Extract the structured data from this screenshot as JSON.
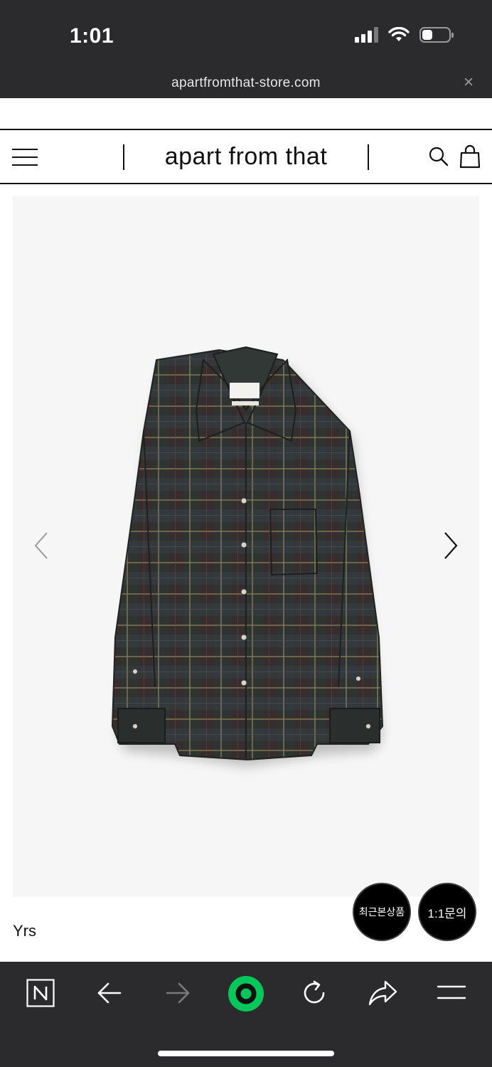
{
  "status_bar": {
    "time": "1:01",
    "icons": [
      "cellular-signal-icon",
      "wifi-icon",
      "battery-icon"
    ]
  },
  "browser": {
    "url": "apartfromthat-store.com",
    "close_icon": "×",
    "toolbar": [
      "naver-n-icon",
      "back-arrow-icon",
      "forward-arrow-icon",
      "naver-green-dot-icon",
      "reload-icon",
      "share-icon",
      "menu-icon"
    ],
    "accent_color": "#03c75a"
  },
  "site": {
    "brand_title": "apart from that",
    "header_icons": [
      "hamburger-menu-icon",
      "search-icon",
      "shopping-bag-icon"
    ]
  },
  "product": {
    "image_alt": "plaid long-sleeve shirt",
    "brand_name": "Yrs",
    "carousel_icons": [
      "chevron-left-icon",
      "chevron-right-icon"
    ]
  },
  "floating_buttons": {
    "recent_label": "최근본상품",
    "inquiry_label": "1:1문의"
  }
}
